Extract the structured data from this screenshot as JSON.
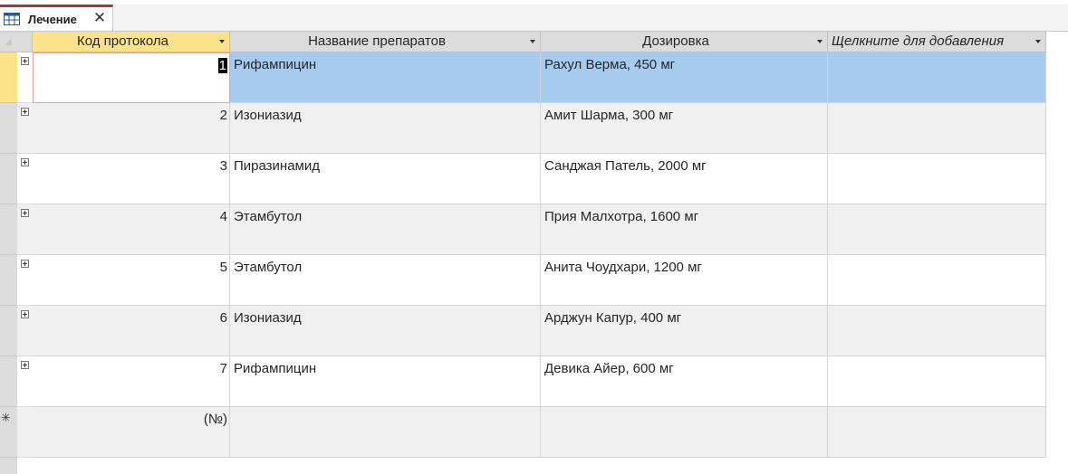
{
  "tab": {
    "label": "Лечение",
    "icon": "table-icon",
    "close": "✕"
  },
  "columns": [
    {
      "label": "Код протокола"
    },
    {
      "label": "Название препаратов"
    },
    {
      "label": "Дозировка"
    },
    {
      "label": "Щелкните для добавления"
    }
  ],
  "rows": [
    {
      "id": "1",
      "drug": "Рифампицин",
      "dose": "Рахул Верма, 450 мг"
    },
    {
      "id": "2",
      "drug": "Изониазид",
      "dose": "Амит Шарма, 300 мг"
    },
    {
      "id": "3",
      "drug": "Пиразинамид",
      "dose": "Санджая Патель, 2000 мг"
    },
    {
      "id": "4",
      "drug": "Этамбутол",
      "dose": "Прия Малхотра, 1600 мг"
    },
    {
      "id": "5",
      "drug": "Этамбутол",
      "dose": "Анита Чоудхари, 1200 мг"
    },
    {
      "id": "6",
      "drug": "Изониазид",
      "dose": "Арджун Капур, 400 мг"
    },
    {
      "id": "7",
      "drug": "Рифампицин",
      "dose": "Девика Айер, 600 мг"
    }
  ],
  "new_row": {
    "marker": "✳",
    "id_placeholder": "(№)"
  },
  "colors": {
    "tab_accent": "#a4373a",
    "active_header": "#fbe28b",
    "selected_row": "#a6cbef"
  }
}
